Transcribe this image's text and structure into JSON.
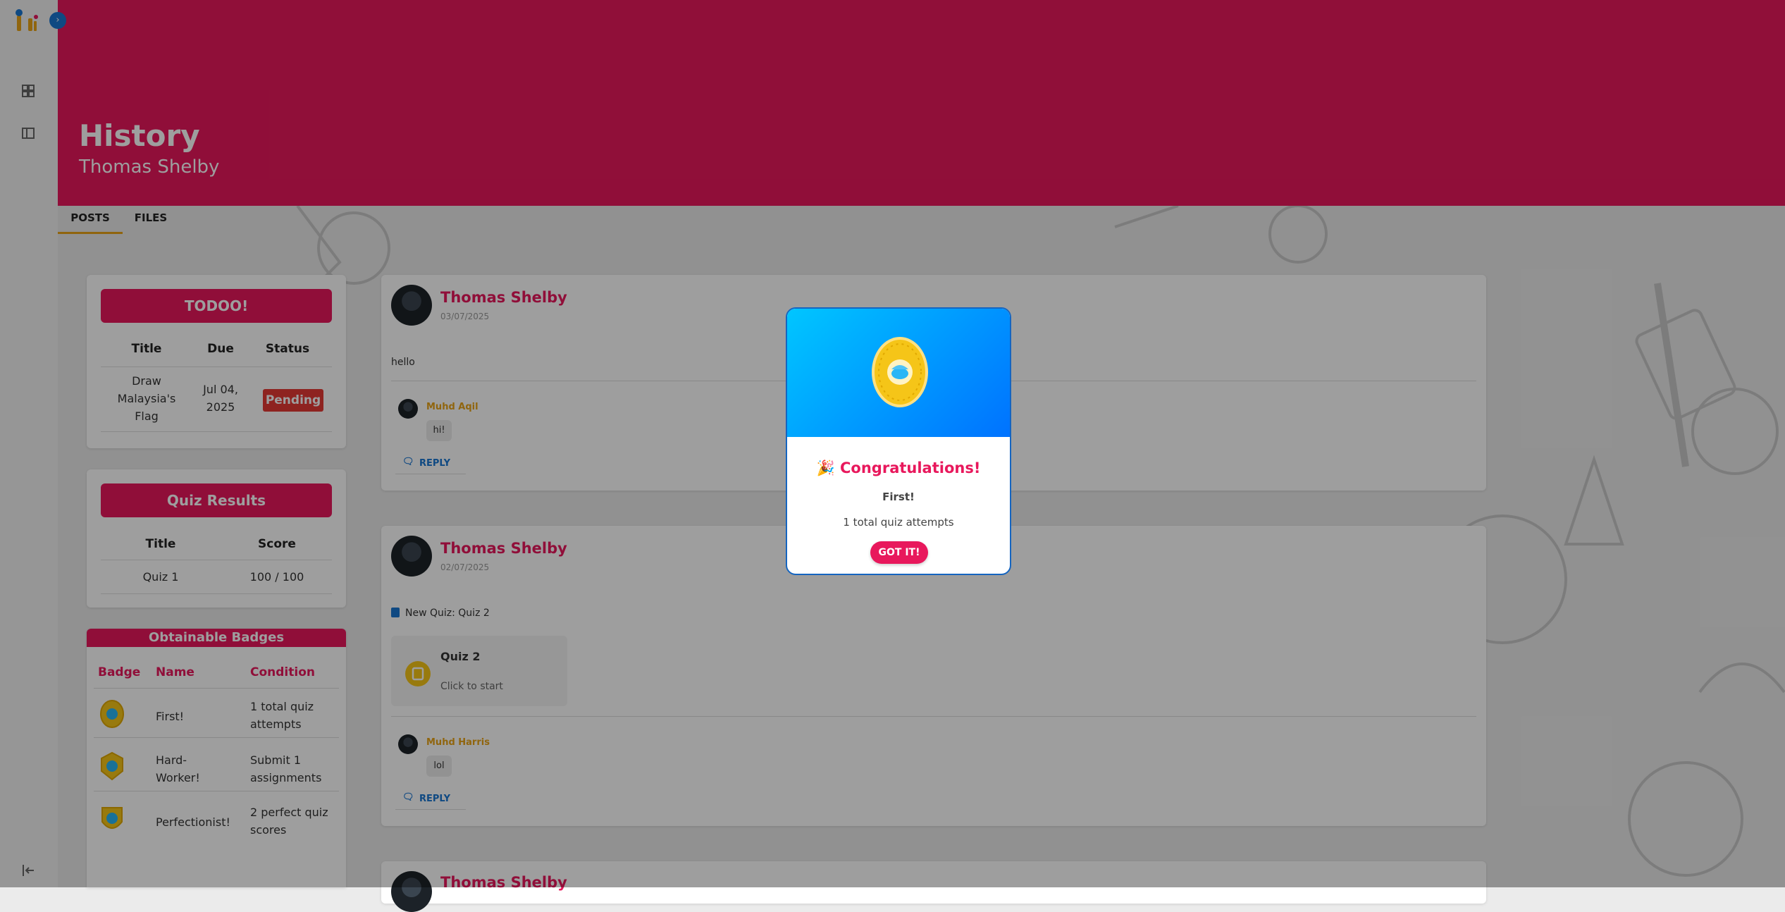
{
  "header": {
    "title": "History",
    "subtitle": "Thomas Shelby"
  },
  "tabs": [
    {
      "label": "POSTS"
    },
    {
      "label": "FILES"
    }
  ],
  "todo": {
    "title": "TODOO!",
    "columns": [
      "Title",
      "Due",
      "Status"
    ],
    "rows": [
      {
        "title_lines": [
          "Draw",
          "Malaysia's",
          "Flag"
        ],
        "due_lines": [
          "Jul 04,",
          "2025"
        ],
        "status": "Pending"
      }
    ]
  },
  "quiz_results": {
    "title": "Quiz Results",
    "columns": [
      "Title",
      "Score"
    ],
    "rows": [
      {
        "title": "Quiz 1",
        "score": "100 / 100"
      }
    ]
  },
  "badges": {
    "title": "Obtainable Badges",
    "columns": [
      "Badge",
      "Name",
      "Condition"
    ],
    "rows": [
      {
        "name_lines": [
          "First!"
        ],
        "condition_lines": [
          "1 total quiz",
          "attempts"
        ]
      },
      {
        "name_lines": [
          "Hard-",
          "Worker!"
        ],
        "condition_lines": [
          "Submit 1",
          "assignments"
        ]
      },
      {
        "name_lines": [
          "Perfectionist!"
        ],
        "condition_lines": [
          "2 perfect quiz",
          "scores"
        ]
      }
    ]
  },
  "posts": [
    {
      "author": "Thomas Shelby",
      "date": "03/07/2025",
      "text": "hello",
      "comment": {
        "author": "Muhd Aqil",
        "text": "hi!"
      },
      "reply_label": "REPLY"
    },
    {
      "author": "Thomas Shelby",
      "date": "02/07/2025",
      "text": "New Quiz: Quiz 2",
      "quiz": {
        "title": "Quiz 2",
        "action": "Click to start"
      },
      "comment": {
        "author": "Muhd Harris",
        "text": "lol"
      },
      "reply_label": "REPLY"
    },
    {
      "author": "Thomas Shelby"
    }
  ],
  "modal": {
    "title": "🎉 Congratulations!",
    "badge_name": "First!",
    "condition": "1 total quiz attempts",
    "button": "GOT IT!"
  },
  "colors": {
    "brand": "#e8185c",
    "accent": "#e8a317",
    "link": "#1976d2"
  },
  "icons": [
    "app-logo-icon",
    "dashboard-icon",
    "sidebar-panel-icon",
    "logout-icon",
    "badge-medal-icon",
    "quiz-icon",
    "comment-icon"
  ]
}
